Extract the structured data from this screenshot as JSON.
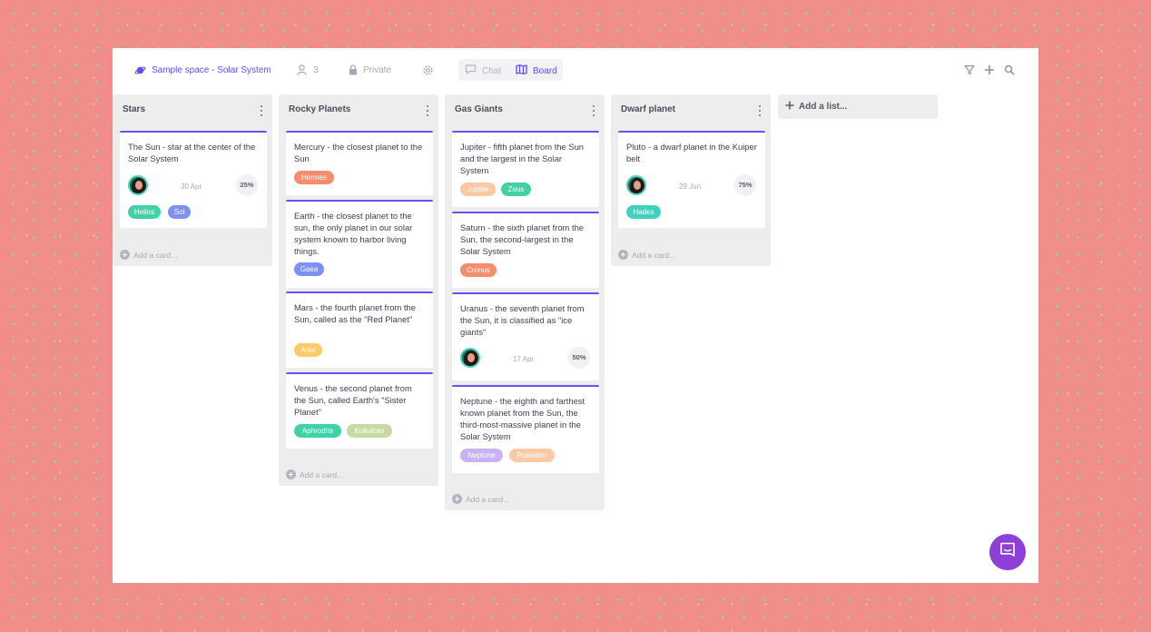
{
  "header": {
    "space_name": "Sample space - Solar System",
    "members_count": "3",
    "privacy": "Private",
    "views": {
      "chat": "Chat",
      "board": "Board"
    },
    "active_view": "Board"
  },
  "colors": {
    "accent": "#5e4ff0",
    "card_border": "#6b4ef6",
    "intercom": "#8e3fd7"
  },
  "lists": [
    {
      "title": "Stars",
      "add_card_label": "Add a card...",
      "cards": [
        {
          "text": "The Sun - star at the center of the Solar System",
          "date": "30 Apr",
          "progress": "25%",
          "tags": [
            "Helios",
            "Sol"
          ]
        }
      ]
    },
    {
      "title": "Rocky Planets",
      "add_card_label": "Add a card...",
      "cards": [
        {
          "text": "Mercury - the closest planet to the Sun",
          "tags": [
            "Hermes"
          ]
        },
        {
          "text": "Earth - the closest planet to the sun, the only planet in our solar system known to harbor living things.",
          "tags": [
            "Gaea"
          ]
        },
        {
          "text": "Mars - the fourth planet from the Sun, called as the \"Red Planet\"",
          "tags": [
            "Ares"
          ]
        },
        {
          "text": "Venus - the second planet from the Sun, called Earth's \"Sister Planet\"",
          "tags": [
            "Aphrodite",
            "Kukulcan"
          ]
        }
      ]
    },
    {
      "title": "Gas Giants",
      "add_card_label": "Add a card...",
      "cards": [
        {
          "text": "Jupiter - fifth planet from the Sun and the largest in the Solar System",
          "tags": [
            "Jupiter",
            "Zeus"
          ]
        },
        {
          "text": "Saturn - the sixth planet from the Sun, the second-largest in the Solar System",
          "tags": [
            "Cronus"
          ]
        },
        {
          "text": "Uranus - the seventh planet from the Sun, it is classified as \"ice giants\"",
          "date": "17 Apr",
          "progress": "50%"
        },
        {
          "text": "Neptune - the eighth and farthest known planet from the Sun, the third-most-massive planet in the Solar System",
          "tags": [
            "Neptune",
            "Poseidon"
          ]
        }
      ]
    },
    {
      "title": "Dwarf planet",
      "add_card_label": "Add a card...",
      "cards": [
        {
          "text": "Pluto - a dwarf planet in the Kuiper belt",
          "date": "29 Jun",
          "progress": "75%",
          "tags": [
            "Hades"
          ]
        }
      ]
    }
  ],
  "add_list_label": "Add a list...",
  "icons": [
    "planet-icon",
    "user-icon",
    "lock-icon",
    "gear-icon",
    "chat-bubble-icon",
    "board-map-icon",
    "filter-icon",
    "plus-icon",
    "search-icon",
    "dots-vertical-icon",
    "plus-circle-icon",
    "chat-widget-icon"
  ]
}
